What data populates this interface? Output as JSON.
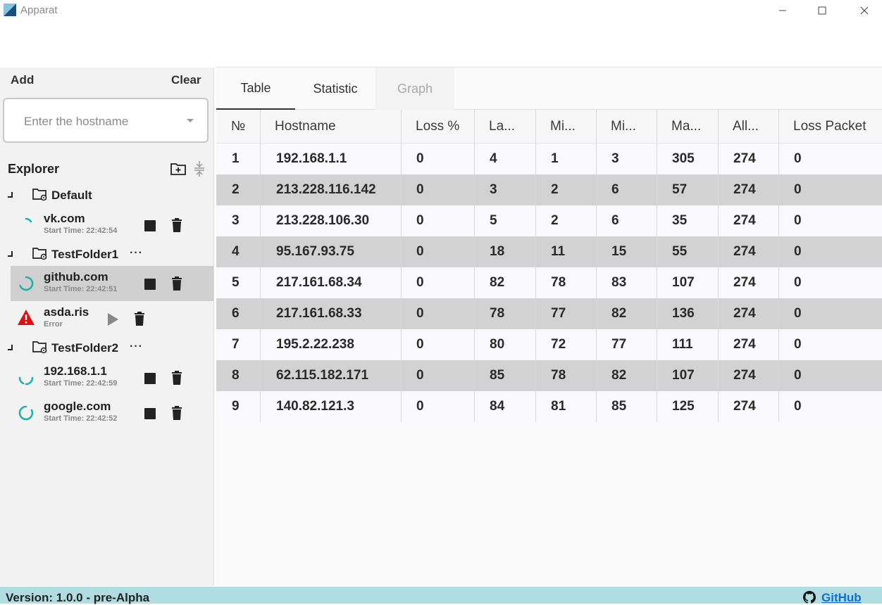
{
  "window": {
    "title": "Apparat",
    "controls": [
      "minimize-icon",
      "maximize-icon",
      "close-icon"
    ]
  },
  "sidebar": {
    "add_label": "Add",
    "clear_label": "Clear",
    "host_input": {
      "placeholder": "Enter the hostname",
      "value": ""
    },
    "explorer_title": "Explorer",
    "folders": [
      {
        "name": "Default",
        "more": "",
        "items": [
          {
            "name": "vk.com",
            "subtitle": "Start Time: 22:42:54",
            "status": "running"
          }
        ]
      },
      {
        "name": "TestFolder1",
        "more": "···",
        "items": [
          {
            "name": "github.com",
            "subtitle": "Start Time: 22:42:51",
            "status": "running",
            "selected": true
          },
          {
            "name": "asda.ris",
            "subtitle": "Error",
            "status": "error"
          }
        ]
      },
      {
        "name": "TestFolder2",
        "more": "···",
        "items": [
          {
            "name": "192.168.1.1",
            "subtitle": "Start Time: 22:42:59",
            "status": "running"
          },
          {
            "name": "google.com",
            "subtitle": "Start Time: 22:42:52",
            "status": "running"
          }
        ]
      }
    ]
  },
  "tabs": [
    {
      "label": "Table",
      "state": "active"
    },
    {
      "label": "Statistic",
      "state": "normal"
    },
    {
      "label": "Graph",
      "state": "disabled"
    }
  ],
  "table": {
    "columns": [
      "№",
      "Hostname",
      "Loss %",
      "La...",
      "Mi...",
      "Mi...",
      "Ma...",
      "All...",
      "Loss Packet"
    ],
    "rows": [
      [
        "1",
        "192.168.1.1",
        "0",
        "4",
        "1",
        "3",
        "305",
        "274",
        "0"
      ],
      [
        "2",
        "213.228.116.142",
        "0",
        "3",
        "2",
        "6",
        "57",
        "274",
        "0"
      ],
      [
        "3",
        "213.228.106.30",
        "0",
        "5",
        "2",
        "6",
        "35",
        "274",
        "0"
      ],
      [
        "4",
        "95.167.93.75",
        "0",
        "18",
        "11",
        "15",
        "55",
        "274",
        "0"
      ],
      [
        "5",
        "217.161.68.34",
        "0",
        "82",
        "78",
        "83",
        "107",
        "274",
        "0"
      ],
      [
        "6",
        "217.161.68.33",
        "0",
        "78",
        "77",
        "82",
        "136",
        "274",
        "0"
      ],
      [
        "7",
        "195.2.22.238",
        "0",
        "80",
        "72",
        "77",
        "111",
        "274",
        "0"
      ],
      [
        "8",
        "62.115.182.171",
        "0",
        "85",
        "78",
        "82",
        "107",
        "274",
        "0"
      ],
      [
        "9",
        "140.82.121.3",
        "0",
        "84",
        "81",
        "85",
        "125",
        "274",
        "0"
      ]
    ]
  },
  "statusbar": {
    "version": "Version: 1.0.0 - pre-Alpha",
    "github_label": "GitHub"
  },
  "colors": {
    "statusbar_bg": "#afdde2",
    "spinner": "#20b2aa",
    "error": "#e01010",
    "link": "#0f6fcf",
    "row_alt": "#d2d2d2"
  }
}
